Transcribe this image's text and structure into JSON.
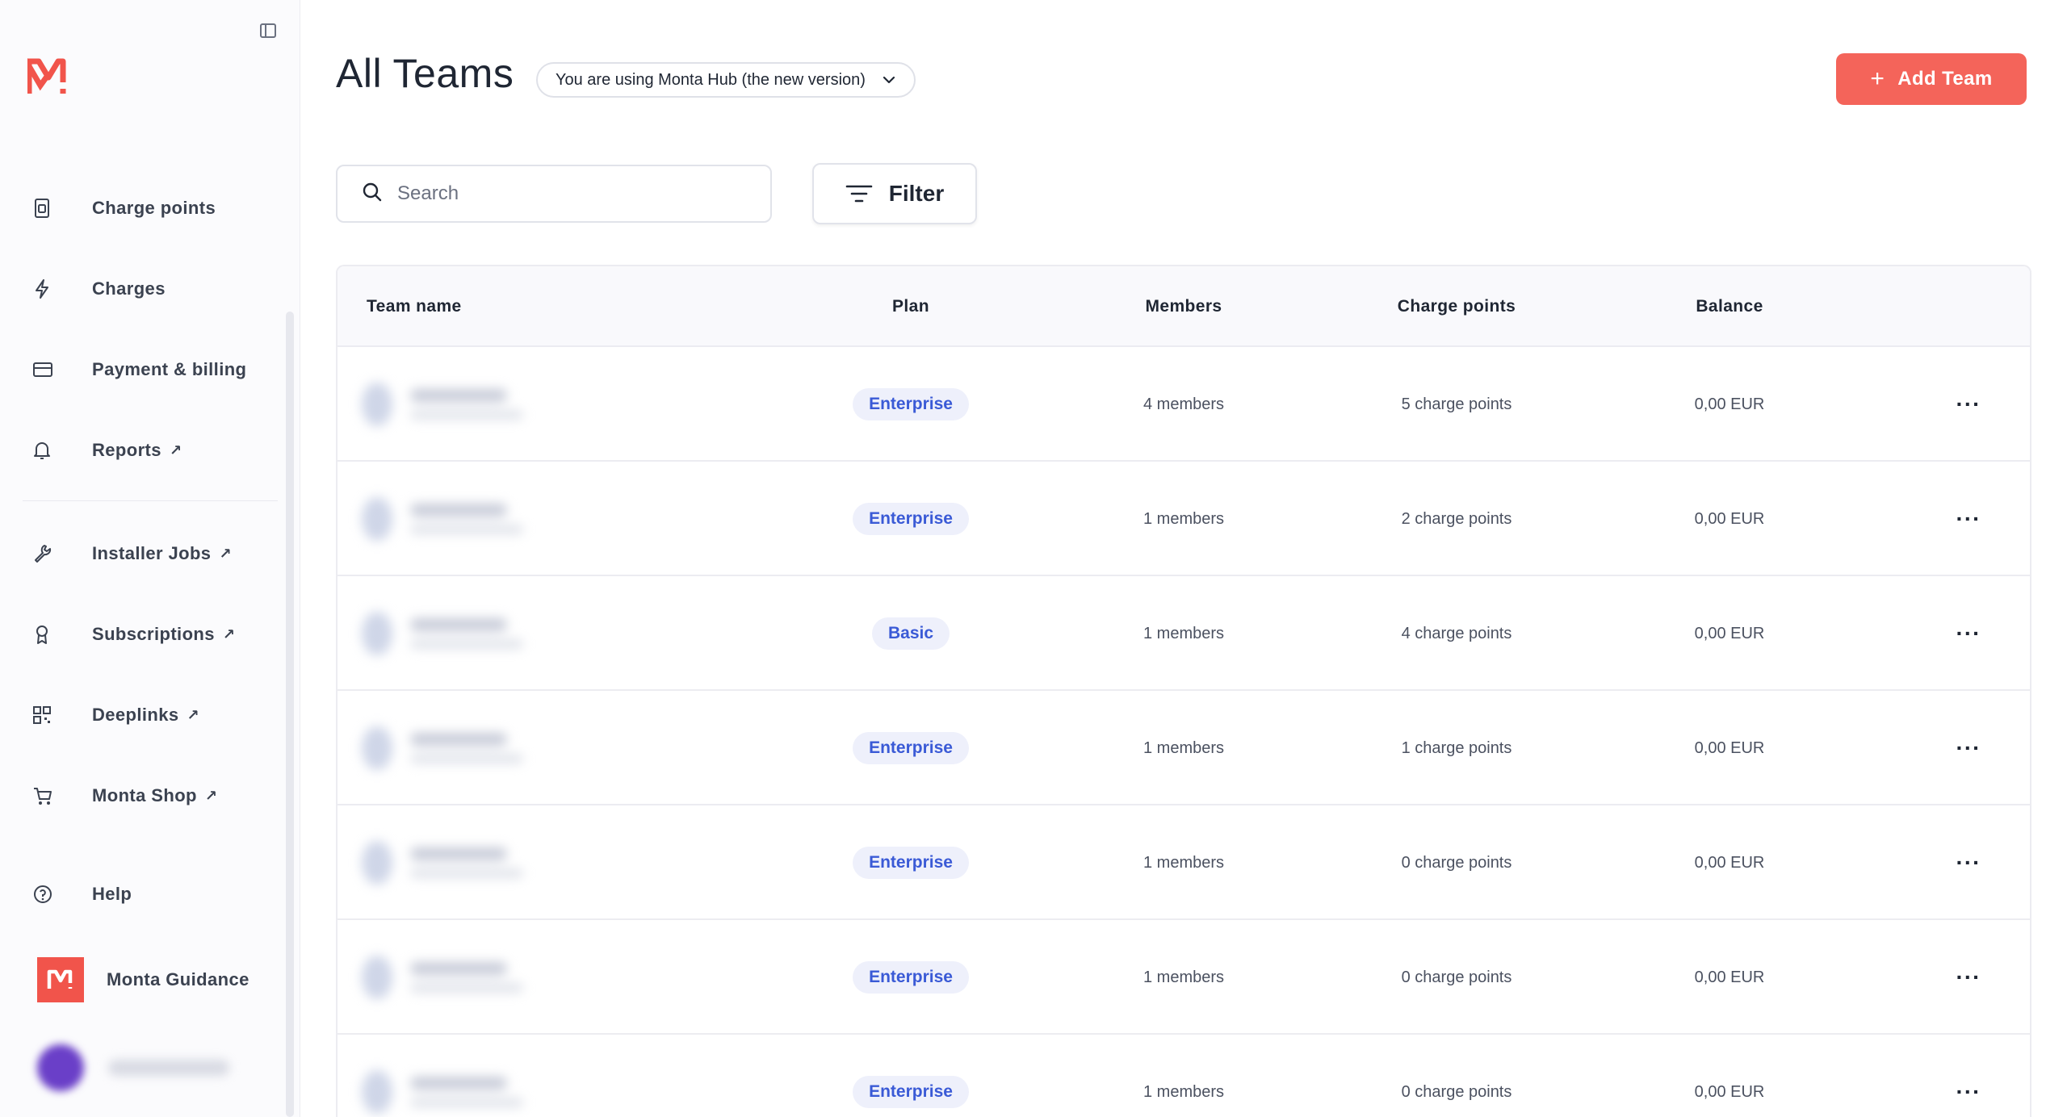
{
  "sidebar": {
    "items": [
      {
        "label": "Charge points",
        "icon": "charge-point-icon",
        "external": false
      },
      {
        "label": "Charges",
        "icon": "lightning-icon",
        "external": false
      },
      {
        "label": "Payment & billing",
        "icon": "credit-card-icon",
        "external": false
      },
      {
        "label": "Reports",
        "icon": "bell-icon",
        "external": true
      },
      {
        "label": "Installer Jobs",
        "icon": "wrench-icon",
        "external": true
      },
      {
        "label": "Subscriptions",
        "icon": "award-icon",
        "external": true
      },
      {
        "label": "Deeplinks",
        "icon": "qr-code-icon",
        "external": true
      },
      {
        "label": "Monta Shop",
        "icon": "shopping-cart-icon",
        "external": true
      },
      {
        "label": "Help",
        "icon": "help-circle-icon",
        "external": false
      }
    ],
    "external_glyph": "↗",
    "guidance_label": "Monta Guidance"
  },
  "header": {
    "title": "All Teams",
    "version_label": "You are using Monta Hub (the new version)",
    "add_team_label": "Add Team"
  },
  "search": {
    "placeholder": "Search",
    "value": ""
  },
  "filter_label": "Filter",
  "table": {
    "columns": [
      "Team name",
      "Plan",
      "Members",
      "Charge points",
      "Balance"
    ],
    "rows": [
      {
        "plan": "Enterprise",
        "members": "4 members",
        "charge_points": "5 charge points",
        "balance": "0,00 EUR"
      },
      {
        "plan": "Enterprise",
        "members": "1 members",
        "charge_points": "2 charge points",
        "balance": "0,00 EUR"
      },
      {
        "plan": "Basic",
        "members": "1 members",
        "charge_points": "4 charge points",
        "balance": "0,00 EUR"
      },
      {
        "plan": "Enterprise",
        "members": "1 members",
        "charge_points": "1 charge points",
        "balance": "0,00 EUR"
      },
      {
        "plan": "Enterprise",
        "members": "1 members",
        "charge_points": "0 charge points",
        "balance": "0,00 EUR"
      },
      {
        "plan": "Enterprise",
        "members": "1 members",
        "charge_points": "0 charge points",
        "balance": "0,00 EUR"
      },
      {
        "plan": "Enterprise",
        "members": "1 members",
        "charge_points": "0 charge points",
        "balance": "0,00 EUR"
      }
    ],
    "row_menu_glyph": "···"
  },
  "colors": {
    "accent": "#f4645a",
    "brand": "#f1544b",
    "plan_text": "#3a5ad6",
    "plan_bg": "#eef0fb"
  }
}
